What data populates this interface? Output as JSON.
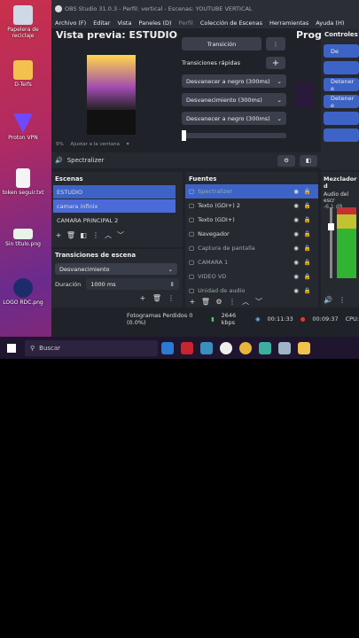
{
  "desktop": {
    "icons": [
      {
        "label": "Papelera de reciclaje"
      },
      {
        "label": "D-Teifs"
      },
      {
        "label": "Proton VPN"
      },
      {
        "label": "token seguir.txt"
      },
      {
        "label": "Sin título.png"
      },
      {
        "label": "LOGO RDC.png"
      }
    ]
  },
  "obs": {
    "window_title": "OBS Studio 31.0.3 - Perfil: vertical - Escenas: YOUTUBE VERTICAL",
    "menu": [
      "Archivo (F)",
      "Editar",
      "Vista",
      "Paneles (D)",
      "Perfil",
      "Colección de Escenas",
      "Herramientas",
      "Ayuda (H)"
    ],
    "preview_title": "Vista previa: ESTUDIO",
    "program_title": "Prog",
    "zoom_label": "9%",
    "zoom_fit": "Ajustar a la ventana",
    "transition_button": "Transición",
    "quick_transitions_label": "Transiciones rápidas",
    "quick_transitions": [
      "Desvanecer a negro (300ms)",
      "Desvanecimiento (300ms)",
      "Desvanecer a negro (300ms)"
    ],
    "spectralizer_label": "Spectralizer",
    "controls": {
      "title": "Controles",
      "buttons": [
        "De",
        "",
        "Detener e",
        "Detener e",
        "",
        ""
      ]
    },
    "scenes": {
      "title": "Escenas",
      "items": [
        "ESTUDIO",
        "camara infinix",
        "CAMARA PRINCIPAL 2"
      ]
    },
    "sources": {
      "title": "Fuentes",
      "items": [
        "Spectralizer",
        "Texto (GDI+) 2",
        "Texto (GDI+)",
        "Navegador",
        "Captura de pantalla",
        "CAMARA 1",
        "VIDEO VD",
        "Unidad de audio"
      ]
    },
    "mixer": {
      "title": "Mezclador d",
      "item": "Audio del escr",
      "level": "-6.1 dB"
    },
    "scene_transitions": {
      "title": "Transiciones de escena",
      "type": "Desvanecimiento",
      "duration_label": "Duración",
      "duration_value": "1000 ms"
    },
    "status": {
      "frames_dropped": "Fotogramas Perdidos 0 (0.0%)",
      "bitrate": "2646 kbps",
      "stream_time": "00:11:33",
      "rec_time": "00:09:37",
      "cpu": "CPU:"
    }
  },
  "taskbar": {
    "search_placeholder": "Buscar"
  }
}
